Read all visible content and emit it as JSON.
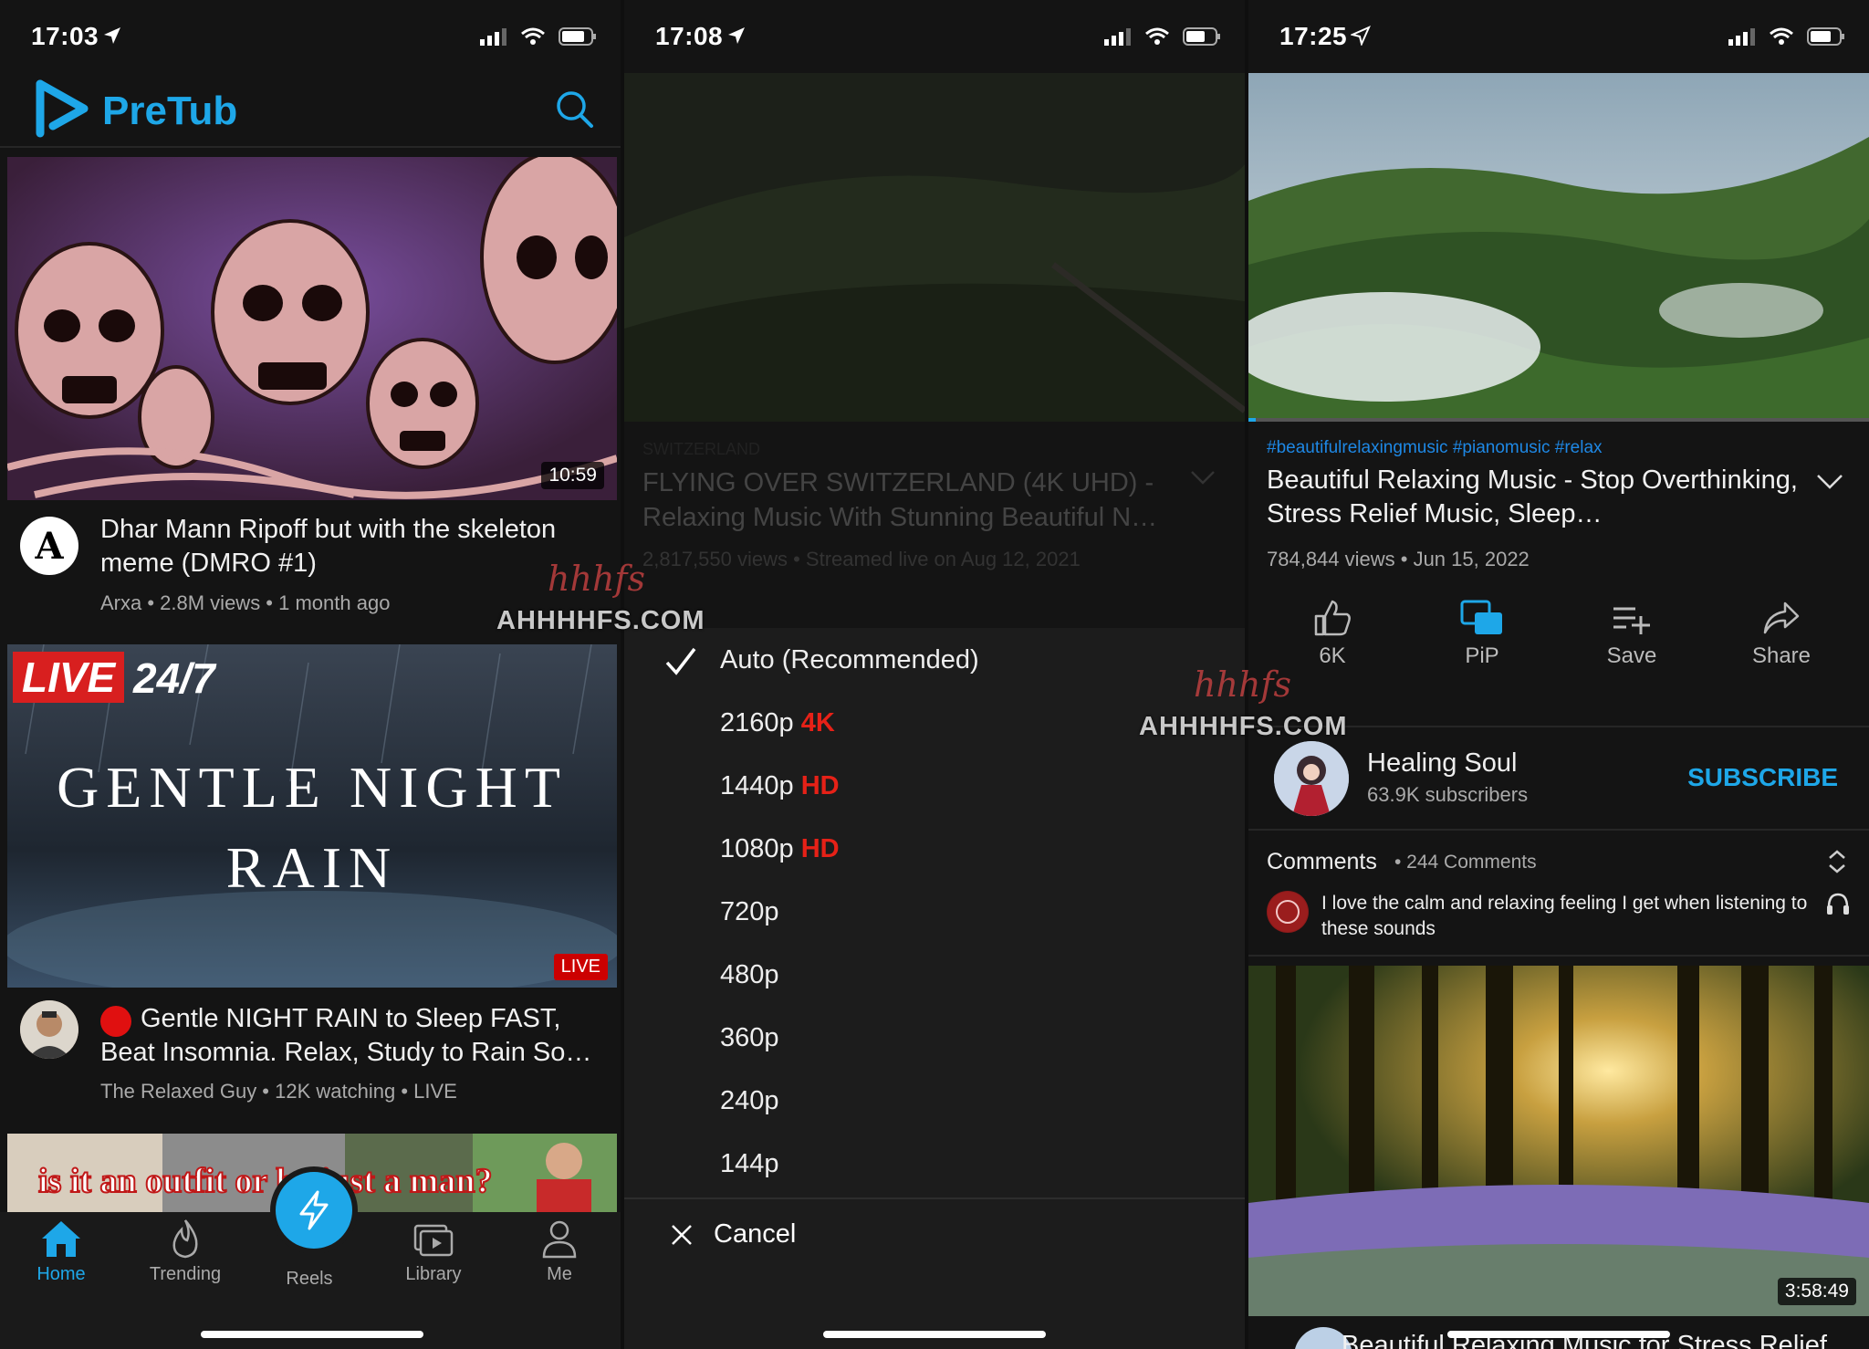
{
  "watermark": {
    "script": "hhhfs",
    "text": "AHHHHFS.COM"
  },
  "screen1": {
    "time": "17:03",
    "app_name": "PreTub",
    "videos": [
      {
        "duration": "10:59",
        "channel_initial": "A",
        "title": "Dhar Mann Ripoff but with the skeleton meme (DMRO #1)",
        "meta": "Arxa • 2.8M views • 1 month ago"
      },
      {
        "thumb_live_badge": "LIVE",
        "thumb_247": "24/7",
        "thumb_line1": "GENTLE NIGHT",
        "thumb_line2": "RAIN",
        "live_corner": "LIVE",
        "title": "Gentle NIGHT RAIN to Sleep FAST, Beat Insomnia. Relax, Study to Rain So…",
        "meta": "The Relaxed Guy • 12K watching • LIVE"
      },
      {
        "thumb_caption": "is it an outfit or he just a man?"
      }
    ],
    "tabs": [
      {
        "label": "Home",
        "icon": "home-icon",
        "active": true
      },
      {
        "label": "Trending",
        "icon": "flame-icon"
      },
      {
        "label": "Reels",
        "icon": "lightning-icon"
      },
      {
        "label": "Library",
        "icon": "library-icon"
      },
      {
        "label": "Me",
        "icon": "person-icon"
      }
    ],
    "accent": "#1ea7e8"
  },
  "screen2": {
    "time": "17:08",
    "bg_tag": "SWITZERLAND",
    "bg_title": "FLYING OVER SWITZERLAND (4K UHD) - Relaxing Music With Stunning Beautiful N…",
    "bg_meta": "2,817,550 views • Streamed live on Aug 12, 2021",
    "quality_options": [
      {
        "label": "Auto (Recommended)",
        "badge": "",
        "selected": true
      },
      {
        "label": "2160p",
        "badge": "4K"
      },
      {
        "label": "1440p",
        "badge": "HD"
      },
      {
        "label": "1080p",
        "badge": "HD"
      },
      {
        "label": "720p",
        "badge": ""
      },
      {
        "label": "480p",
        "badge": ""
      },
      {
        "label": "360p",
        "badge": ""
      },
      {
        "label": "240p",
        "badge": ""
      },
      {
        "label": "144p",
        "badge": ""
      }
    ],
    "cancel_label": "Cancel",
    "badge_color": "#e62117"
  },
  "screen3": {
    "time": "17:25",
    "hashtags": "#beautifulrelaxingmusic #pianomusic #relax",
    "title": "Beautiful Relaxing Music - Stop Overthinking, Stress Relief Music, Sleep…",
    "meta": "784,844 views • Jun 15, 2022",
    "actions": [
      {
        "label": "6K",
        "icon": "thumbs-up-icon"
      },
      {
        "label": "PiP",
        "icon": "pip-icon"
      },
      {
        "label": "Save",
        "icon": "playlist-add-icon"
      },
      {
        "label": "Share",
        "icon": "share-icon"
      }
    ],
    "channel": {
      "name": "Healing Soul",
      "subs": "63.9K subscribers",
      "subscribe": "SUBSCRIBE"
    },
    "comments": {
      "label": "Comments",
      "count": "• 244 Comments",
      "text": "I love the calm and relaxing feeling I get when listening to these sounds"
    },
    "next_video": {
      "duration": "3:58:49",
      "title": "Beautiful Relaxing Music for Stress Relief"
    }
  }
}
